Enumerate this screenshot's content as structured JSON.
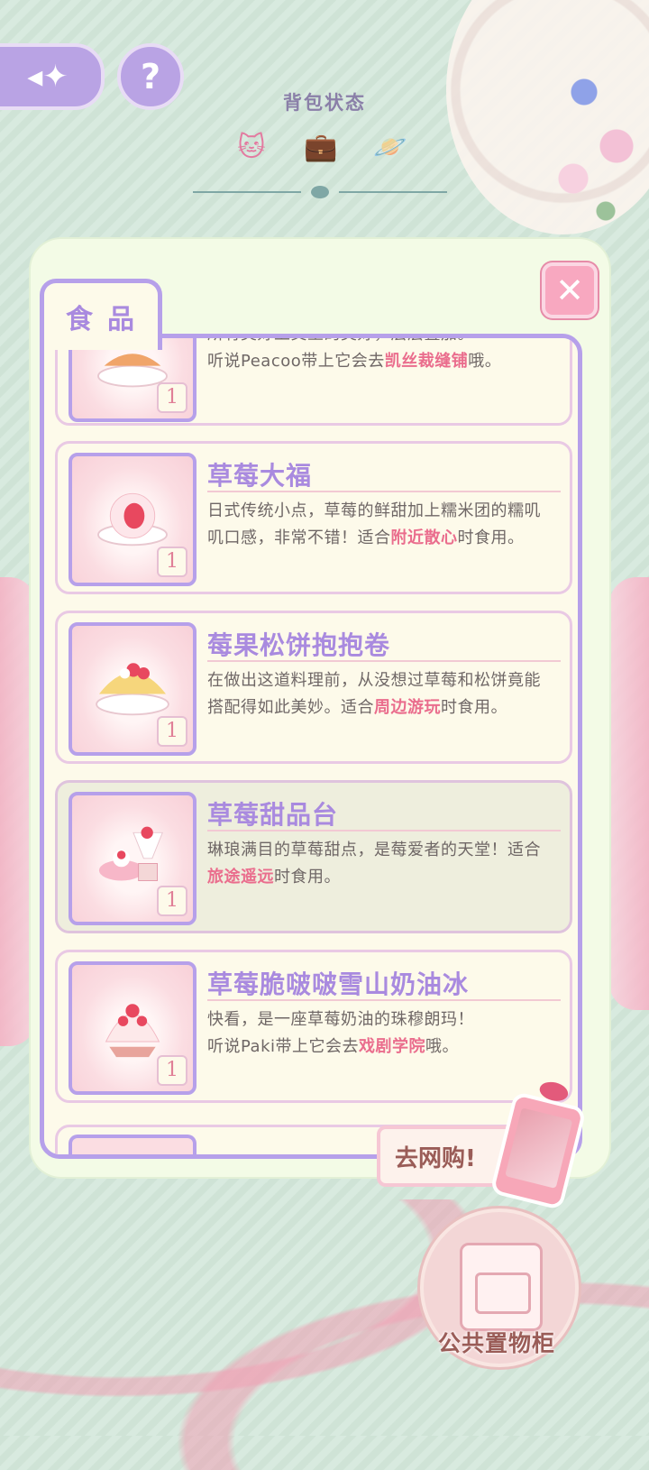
{
  "header": {
    "back_icon": "back-arrow-icon",
    "help_label": "?",
    "status_title": "背包状态",
    "status_icons": [
      "cat-bag-icon",
      "suitcase-icon",
      "planet-icon"
    ]
  },
  "panel": {
    "tab_label": "食品",
    "close_label": "✕",
    "items": [
      {
        "name": "",
        "desc_parts": [
          {
            "text": "所有美好上交至的美好，层层叠加。",
            "hl": false
          },
          {
            "text": "听说Peacoo带上它会去",
            "hl": false
          },
          {
            "text": "凯丝裁缝铺",
            "hl": true
          },
          {
            "text": "哦。",
            "hl": false
          }
        ],
        "qty": "1"
      },
      {
        "name": "草莓大福",
        "desc_parts": [
          {
            "text": "日式传统小点，草莓的鲜甜加上糯米团的糯叽叽口感，非常不错！适合",
            "hl": false
          },
          {
            "text": "附近散心",
            "hl": true
          },
          {
            "text": "时食用。",
            "hl": false
          }
        ],
        "qty": "1"
      },
      {
        "name": "莓果松饼抱抱卷",
        "desc_parts": [
          {
            "text": "在做出这道料理前，从没想过草莓和松饼竟能搭配得如此美妙。适合",
            "hl": false
          },
          {
            "text": "周边游玩",
            "hl": true
          },
          {
            "text": "时食用。",
            "hl": false
          }
        ],
        "qty": "1"
      },
      {
        "name": "草莓甜品台",
        "desc_parts": [
          {
            "text": "琳琅满目的草莓甜点，是莓爱者的天堂！适合",
            "hl": false
          },
          {
            "text": "旅途遥远",
            "hl": true
          },
          {
            "text": "时食用。",
            "hl": false
          }
        ],
        "qty": "1"
      },
      {
        "name": "草莓脆啵啵雪山奶油冰",
        "desc_parts": [
          {
            "text": "快看，是一座草莓奶油的珠穆朗玛！",
            "hl": false
          },
          {
            "text": "听说Paki带上它会去",
            "hl": false
          },
          {
            "text": "戏剧学院",
            "hl": true
          },
          {
            "text": "哦。",
            "hl": false
          }
        ],
        "qty": "1"
      }
    ]
  },
  "shop_button_label": "去网购!",
  "cabinet_label": "公共置物柜",
  "colors": {
    "accent_purple": "#b6a0ea",
    "highlight_pink": "#ea6d8d",
    "panel_bg": "#f3fbe6"
  }
}
